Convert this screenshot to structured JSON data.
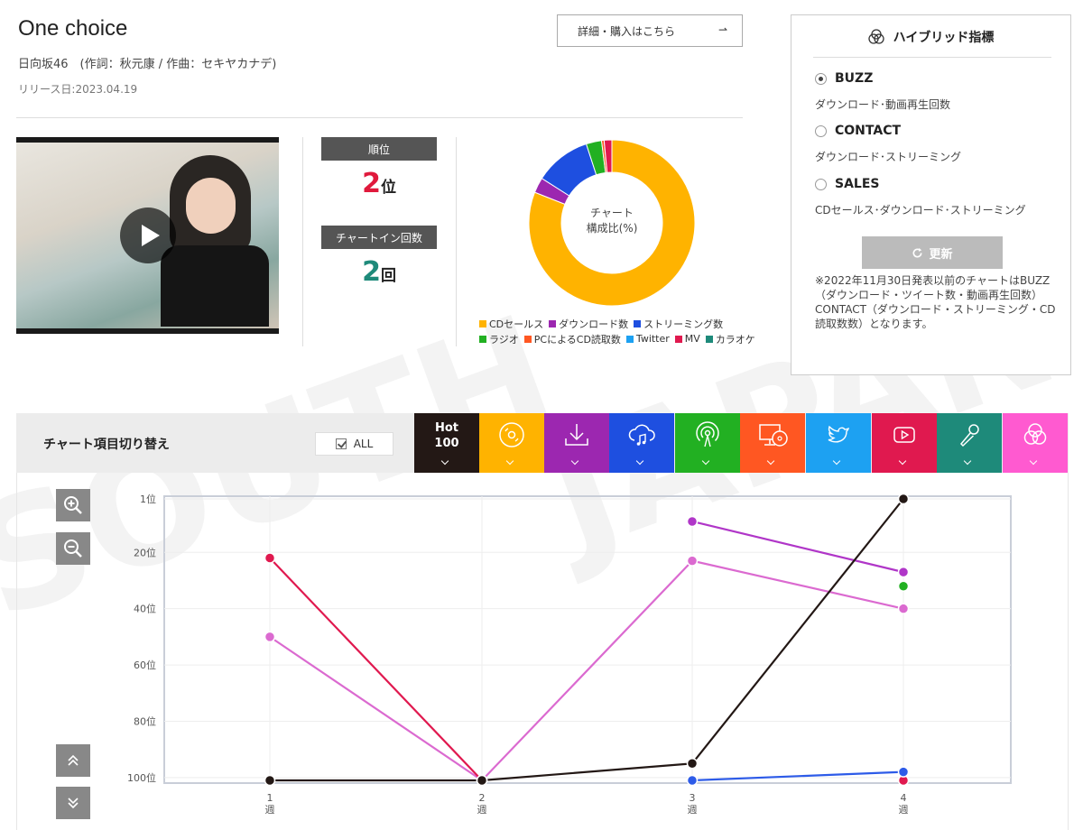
{
  "song": {
    "title": "One choice",
    "artist_line": "日向坂46　(作詞：秋元康 / 作曲：セキヤカナデ)",
    "release": "リリース日:2023.04.19",
    "buy_label": "詳細・購入はこちら"
  },
  "stats": {
    "rank_label": "順位",
    "rank_value": "2",
    "rank_unit": "位",
    "count_label": "チャートイン回数",
    "count_value": "2",
    "count_unit": "回"
  },
  "composition": {
    "center_line1": "チャート",
    "center_line2": "構成比(%)",
    "slices": [
      {
        "name": "CDセールス",
        "value": 81,
        "color": "#ffb300"
      },
      {
        "name": "ダウンロード数",
        "value": 3,
        "color": "#9c27b0"
      },
      {
        "name": "ストリーミング数",
        "value": 11,
        "color": "#1e4fe0"
      },
      {
        "name": "ラジオ",
        "value": 3,
        "color": "#22b022"
      },
      {
        "name": "PCによるCD読取数",
        "value": 0.5,
        "color": "#ff5722"
      },
      {
        "name": "Twitter",
        "value": 0,
        "color": "#1da1f2"
      },
      {
        "name": "MV",
        "value": 1.5,
        "color": "#e0194f"
      },
      {
        "name": "カラオケ",
        "value": 0,
        "color": "#1e8a7a"
      }
    ]
  },
  "hybrid": {
    "title": "ハイブリッド指標",
    "options": [
      {
        "label": "BUZZ",
        "desc": "ダウンロード･動画再生回数",
        "selected": true
      },
      {
        "label": "CONTACT",
        "desc": "ダウンロード･ストリーミング",
        "selected": false
      },
      {
        "label": "SALES",
        "desc": "CDセールス･ダウンロード･ストリーミング",
        "selected": false
      }
    ],
    "update_label": "更新",
    "note": "※2022年11月30日発表以前のチャートはBUZZ（ダウンロード・ツイート数・動画再生回数）CONTACT（ダウンロード・ストリーミング・CD読取数数）となります。"
  },
  "toolbar": {
    "label": "チャート項目切り替え",
    "all_label": "ALL",
    "hot_line1": "Hot",
    "hot_line2": "100",
    "categories": [
      {
        "icon": "hot100",
        "color": "#231815"
      },
      {
        "icon": "cd-icon",
        "color": "#ffb300"
      },
      {
        "icon": "download-icon",
        "color": "#9c27b0"
      },
      {
        "icon": "streaming-icon",
        "color": "#1e4fe0"
      },
      {
        "icon": "radio-icon",
        "color": "#22b022"
      },
      {
        "icon": "pc-cd-icon",
        "color": "#ff5722"
      },
      {
        "icon": "twitter-icon",
        "color": "#1da1f2"
      },
      {
        "icon": "mv-icon",
        "color": "#e0194f"
      },
      {
        "icon": "karaoke-icon",
        "color": "#1e8a7a"
      },
      {
        "icon": "hybrid-icon",
        "color": "#ff5ad0"
      }
    ]
  },
  "chart_data": {
    "type": "line",
    "x": [
      "1\n週",
      "2\n週",
      "3\n週",
      "4\n週"
    ],
    "y_ticks": [
      "1位",
      "20位",
      "40位",
      "60位",
      "80位",
      "100位"
    ],
    "y_tick_values": [
      1,
      20,
      40,
      60,
      80,
      100
    ],
    "ylim": [
      1,
      101
    ],
    "y_inverted": true,
    "grid": true,
    "series": [
      {
        "key": "hot100",
        "color": "#231815",
        "values": [
          101,
          101,
          95,
          1
        ]
      },
      {
        "key": "hybrid",
        "color": "#db6ad0",
        "values": [
          50,
          101,
          23,
          40
        ]
      },
      {
        "key": "mv",
        "color": "#e0194f",
        "values": [
          22,
          101,
          null,
          101
        ]
      },
      {
        "key": "download",
        "color": "#b036c8",
        "values": [
          null,
          null,
          9,
          27
        ]
      },
      {
        "key": "streaming",
        "color": "#2d5be8",
        "values": [
          null,
          null,
          101,
          98
        ]
      },
      {
        "key": "radio",
        "color": "#22b022",
        "values": [
          null,
          null,
          null,
          32
        ]
      }
    ]
  }
}
